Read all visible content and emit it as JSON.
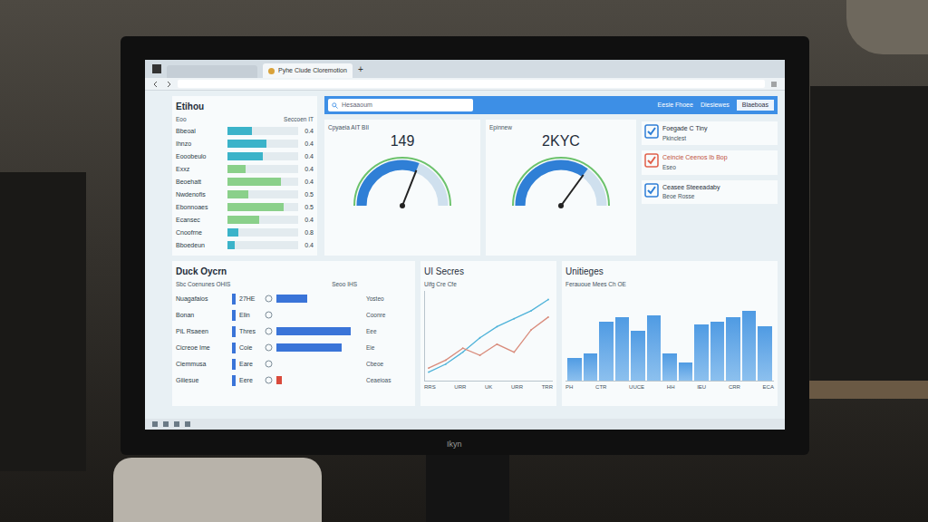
{
  "monitor": {
    "brand": "Ikyn"
  },
  "browser": {
    "tab_title": "Pyhe Ciude Cloremotion",
    "new_tab": "+"
  },
  "sidebar": {
    "title": "Etihou",
    "columns": [
      "Eoo",
      "Seccoen IT"
    ],
    "rows": [
      {
        "label": "Bbeoal",
        "value": "0.4",
        "level": 0.35,
        "color": "#3bb3c9"
      },
      {
        "label": "Ihnzo",
        "value": "0.4",
        "level": 0.55,
        "color": "#3bb3c9"
      },
      {
        "label": "Eooobeulo",
        "value": "0.4",
        "level": 0.5,
        "color": "#3bb3c9"
      },
      {
        "label": "Exxz",
        "value": "0.4",
        "level": 0.25,
        "color": "#8ad08a"
      },
      {
        "label": "Beoehatt",
        "value": "0.4",
        "level": 0.75,
        "color": "#8ad08a"
      },
      {
        "label": "Nwdenofis",
        "value": "0.5",
        "level": 0.3,
        "color": "#8ad08a"
      },
      {
        "label": "Ebonnoaes",
        "value": "0.5",
        "level": 0.8,
        "color": "#8ad08a"
      },
      {
        "label": "Ecansec",
        "value": "0.4",
        "level": 0.45,
        "color": "#8ad08a"
      },
      {
        "label": "Cnoofrne",
        "value": "0.8",
        "level": 0.15,
        "color": "#3bb3c9"
      },
      {
        "label": "Bboedeun",
        "value": "0.4",
        "level": 0.1,
        "color": "#3bb3c9"
      }
    ]
  },
  "search": {
    "placeholder": "Hesaaoum",
    "links": [
      "Eesie Fhoee",
      "Diesiewes"
    ],
    "field": "Blaeboas"
  },
  "gauges": [
    {
      "caption": "Cpyaeia AIT BII",
      "value": "149",
      "level": 0.62
    },
    {
      "caption": "Epinnew",
      "value": "2KYC",
      "level": 0.7
    }
  ],
  "alerts": [
    {
      "title": "Foegade C Tiny",
      "subtitle": "Pkinclest",
      "color": "#2f7fd6"
    },
    {
      "title": "Ceincie Ceenos Ib Bop",
      "subtitle": "Eseo",
      "color": "#e0604a"
    },
    {
      "title": "Ceasee Steeeadaby",
      "subtitle": "Beoe Rosse",
      "color": "#2f7fd6"
    }
  ],
  "duck": {
    "title": "Duck Oycrn",
    "subtitle": "Sbc Coenunes OHIS",
    "column": "Seoo IHS",
    "rows": [
      {
        "label": "Nuagafaios",
        "value": "27HE",
        "level": 0.35,
        "note": "Yosteo",
        "color": "#3a74d8"
      },
      {
        "label": "Bonan",
        "value": "Elin",
        "level": 0.0,
        "note": "Coonre",
        "color": "#3a74d8"
      },
      {
        "label": "PiL Rsaeen",
        "value": "Thres",
        "level": 0.85,
        "note": "Eee",
        "color": "#3a74d8"
      },
      {
        "label": "Cicreoe Ime",
        "value": "Coie",
        "level": 0.75,
        "note": "Eie",
        "color": "#3a74d8"
      },
      {
        "label": "Ciemmusa",
        "value": "Eare",
        "level": 0.0,
        "note": "Cbeoe",
        "color": "#3a74d8"
      },
      {
        "label": "Giiiesue",
        "value": "Eere",
        "level": 0.06,
        "note": "Ceaeioas",
        "color": "#d94a3c"
      }
    ]
  },
  "line_chart": {
    "title": "UI Secres",
    "subtitle": "Uifg Cre Cfe",
    "series": [
      {
        "color": "#4fb3d9",
        "values": [
          5,
          15,
          30,
          48,
          62,
          72,
          82,
          96
        ]
      },
      {
        "color": "#d98c7c",
        "values": [
          10,
          20,
          35,
          26,
          40,
          30,
          58,
          74
        ]
      }
    ],
    "ticks": [
      "RRS",
      "URR",
      "UK",
      "URR",
      "TRR"
    ]
  },
  "bar_chart": {
    "title": "Unitieges",
    "subtitle": "Ferauoue Mees Ch OE",
    "values": [
      25,
      30,
      65,
      70,
      55,
      72,
      30,
      20,
      62,
      65,
      70,
      78,
      60
    ],
    "ticks": [
      "PH",
      "CTR",
      "UUCE",
      "HH",
      "IEU",
      "CRR",
      "ECA"
    ]
  }
}
